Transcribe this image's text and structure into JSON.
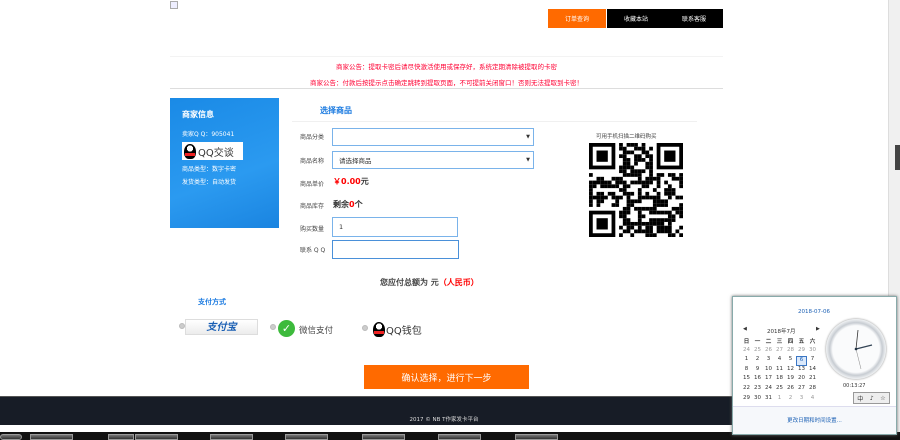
{
  "nav": [
    {
      "label": "订单查询",
      "color": "#ff6a00"
    },
    {
      "label": "收藏本站",
      "color": "#000000"
    },
    {
      "label": "联系客服",
      "color": "#000000"
    }
  ],
  "notices": [
    "商家公告：提取卡密后请尽快激活使用或保存好，系统定期清除被提取的卡密",
    "商家公告：付款后按提示点击确定跳转到提取页面，不可提前关闭窗口！否则无法提取到卡密！"
  ],
  "shop": {
    "title": "商家信息",
    "qq": "卖家Q Q：905041",
    "qq_button": "QQ交谈",
    "goods_type": "商品类型：数字卡密",
    "delivery": "发货类型：自动发货"
  },
  "form": {
    "title": "选择商品",
    "category_label": "商品分类",
    "category_value": "",
    "name_label": "商品名称",
    "name_value": "请选择商品",
    "price_label": "商品单价",
    "price_value": "￥0.00",
    "price_unit": "元",
    "stock_label": "商品库存",
    "stock_prefix": "剩余",
    "stock_value": "0",
    "stock_unit": "个",
    "qty_label": "购买数量",
    "qty_value": "1",
    "contact_label": "联系 Q Q",
    "contact_value": ""
  },
  "qr": {
    "caption": "可用手机扫描二维码购买"
  },
  "total": {
    "prefix": "您应付总额为 元",
    "currency": "（人民币）"
  },
  "payment": {
    "title": "支付方式",
    "options": [
      "支付宝",
      "微信支付",
      "QQ钱包"
    ]
  },
  "confirm_label": "确认选择，进行下一步",
  "footer": "2017 © NB T作家发卡平台",
  "calendar": {
    "date": "2018-07-06",
    "month": "2018年7月",
    "weekdays": [
      "日",
      "一",
      "二",
      "三",
      "四",
      "五",
      "六"
    ],
    "days": [
      [
        "24",
        "25",
        "26",
        "27",
        "28",
        "29",
        "30"
      ],
      [
        "1",
        "2",
        "3",
        "4",
        "5",
        "6",
        "7"
      ],
      [
        "8",
        "9",
        "10",
        "11",
        "12",
        "13",
        "14"
      ],
      [
        "15",
        "16",
        "17",
        "18",
        "19",
        "20",
        "21"
      ],
      [
        "22",
        "23",
        "24",
        "25",
        "26",
        "27",
        "28"
      ],
      [
        "29",
        "30",
        "31",
        "1",
        "2",
        "3",
        "4"
      ]
    ],
    "selected": "6",
    "time": "00:13:27",
    "ime": [
      "中",
      "♪",
      "☆"
    ],
    "settings_link": "更改日期和时间设置..."
  }
}
